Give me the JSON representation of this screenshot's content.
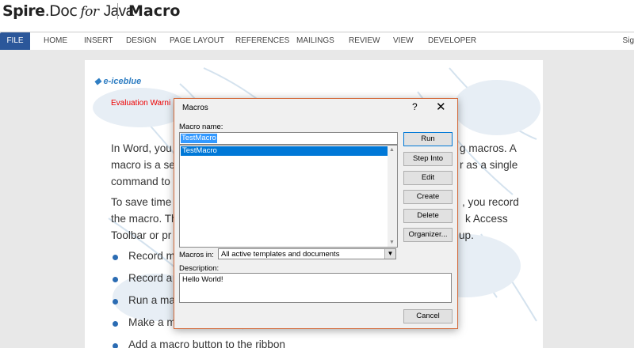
{
  "header": {
    "brand_spire": "Spire",
    "brand_doc": ".Doc",
    "brand_for": "for",
    "brand_java": "Java",
    "page_title": "Macro"
  },
  "ribbon": {
    "tabs": [
      "FILE",
      "HOME",
      "INSERT",
      "DESIGN",
      "PAGE LAYOUT",
      "REFERENCES",
      "MAILINGS",
      "REVIEW",
      "VIEW",
      "DEVELOPER"
    ],
    "right_label": "Sig",
    "file_color": "#2b579a"
  },
  "document": {
    "logo": "e-iceblue",
    "evaluation": "Evaluation Warni",
    "para1": [
      "In Word, you",
      "g macros. A",
      "macro is a se",
      "r as a single",
      "command to"
    ],
    "para2": [
      "To save time",
      ", you record",
      "the macro. Th",
      "k Access",
      "Toolbar or pr",
      "up."
    ],
    "bullets": [
      "Record ma",
      "Record a n",
      "Run a mac",
      "Make a m",
      "Add a macro button to the ribbon"
    ],
    "bullet_color": "#2b6cb3"
  },
  "dialog": {
    "title": "Macros",
    "help": "?",
    "close": "✕",
    "macro_name_label": "Macro name:",
    "macro_name_value": "TestMacro",
    "list_items": [
      "TestMacro"
    ],
    "buttons": {
      "run": "Run",
      "step_into": "Step Into",
      "edit": "Edit",
      "create": "Create",
      "delete": "Delete",
      "organizer": "Organizer...",
      "cancel": "Cancel"
    },
    "macros_in_label": "Macros in:",
    "macros_in_value": "All active templates and documents",
    "description_label": "Description:",
    "description_value": "Hello World!",
    "border_color": "#d46b3c",
    "selection_color": "#0078d7"
  }
}
